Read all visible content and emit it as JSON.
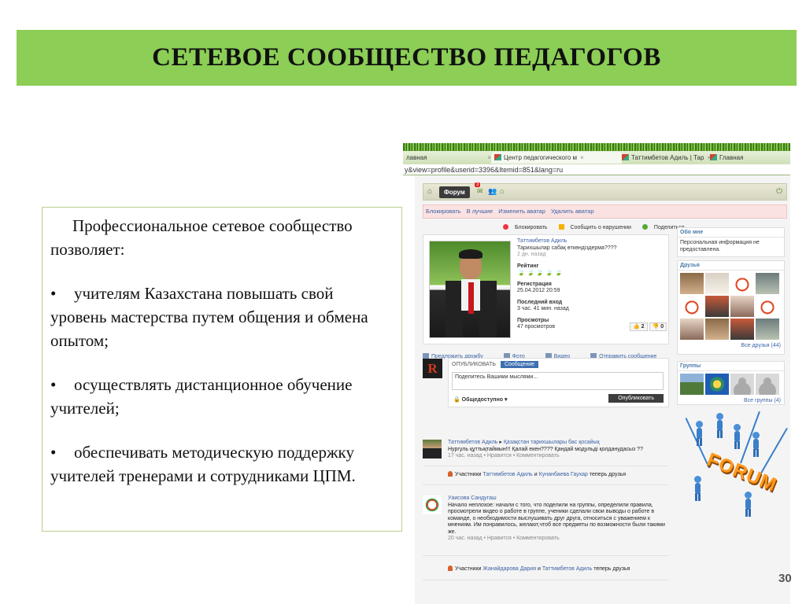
{
  "title": "СЕТЕВОЕ СООБЩЕСТВО ПЕДАГОГОВ",
  "text_box": {
    "intro": "Профессиональное сетевое сообщество позволяет:",
    "bullet_symbol": "•",
    "bullets": [
      "учителям Казахстана повышать свой уровень мастерства путем общения и обмена опытом;",
      "осуществлять дистанционное обучение учителей;",
      "обеспечивать методическую поддержку учителей тренерами и сотрудниками ЦПМ."
    ]
  },
  "screenshot": {
    "tabs": [
      {
        "label": "лавная",
        "close": "×"
      },
      {
        "label": "Центр педагогического м",
        "close": "×"
      },
      {
        "label": "Таттимбетов Адиль | Тар",
        "close": "×"
      },
      {
        "label": "Главная",
        "close": ""
      }
    ],
    "url": "y&view=profile&userid=3396&Itemid=851&lang=ru",
    "forum_tab": "Форум",
    "notification_count": "3",
    "actions": [
      "Блокировать",
      "В лучшие",
      "Изменить аватар",
      "Удалить аватар"
    ],
    "report_row": [
      "Блокировать",
      "Сообщить о нарушении",
      "Поделиться"
    ],
    "profile": {
      "name": "Таттимбетов Адиль",
      "status": "Тарихшылар сабақ өткөндіздерма????",
      "status_time": "2 дн. назад",
      "rating_label": "Рейтинг",
      "rating_icons": "🍃🍃🍃🍃🍃",
      "rating": 1,
      "rating_max": 5,
      "registration_label": "Регистрация",
      "registration_value": "25.04.2012 20:59",
      "last_login_label": "Последний вход",
      "last_login_value": "3 час. 41 мин. назад",
      "views_label": "Просмотры",
      "views_value": "47 просмотров",
      "votes_up": "2",
      "votes_down": "0"
    },
    "profile_links": [
      "Предложить дружбу",
      "Фото",
      "Видео",
      "Отправить сообщение"
    ],
    "about": {
      "header": "Обо мне",
      "text": "Персональная информация не предоставлена."
    },
    "friends": {
      "header": "Друзья",
      "more": "Все друзья (44)"
    },
    "groups": {
      "header": "Группы",
      "more": "Все группы (4)"
    },
    "post_box": {
      "tab_publish": "ОПУБЛИКОВАТЬ",
      "tab_message": "Сообщение",
      "placeholder": "Поделитесь Вашими мыслями...",
      "privacy": "Общедоступно",
      "submit": "Опубликовать"
    },
    "feed": [
      {
        "author": "Таттимбетов Адиль",
        "target": "Қазақстан тарихшылары бас қосайық",
        "text": "Нургуль құттықтаймын!!! Қалай екен???? Қандай модульді қолданудасыз ??",
        "meta": "17 час. назад • Нравится • Комментировать"
      },
      {
        "prefix": "Участники",
        "user1": "Таттимбетов Адиль",
        "conj": "и",
        "user2": "Кунанбаева Гаухар",
        "suffix": "теперь друзья"
      },
      {
        "author": "Уаисова Сандугаш",
        "text": "Начало неплохое: начали с того, что поделили на группы, определили правила, просмотрели видео о работе в группе, ученики сделали свои выводы о работе в команде, о необходимости выслушивать друг друга, относиться с уважением к мнениям. Им понравилось, желают,чтоб все предметы по возможности были такими же.",
        "meta": "20 час. назад • Нравится • Комментировать"
      },
      {
        "prefix": "Участники",
        "user1": "Жанайдарова Дария",
        "conj": "и",
        "user2": "Таттимбетов Адиль",
        "suffix": "теперь друзья"
      }
    ]
  },
  "forum_sign": "FORUM",
  "page_number": "30",
  "colors": {
    "title_bg": "#8cce56",
    "text_border": "#b9d08d"
  }
}
